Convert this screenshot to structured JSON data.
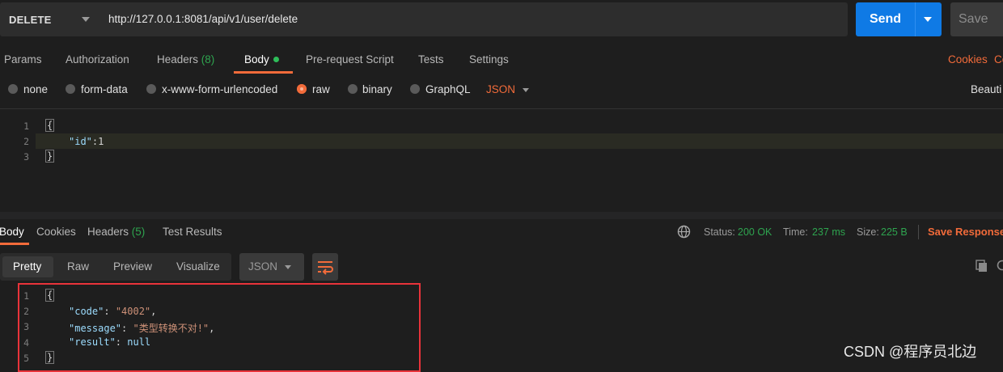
{
  "request": {
    "method": "DELETE",
    "url": "http://127.0.0.1:8081/api/v1/user/delete",
    "send_label": "Send",
    "save_label": "Save"
  },
  "request_tabs": {
    "params": "Params",
    "authorization": "Authorization",
    "headers": "Headers",
    "headers_count": "(8)",
    "body": "Body",
    "prerequest": "Pre-request Script",
    "tests": "Tests",
    "settings": "Settings",
    "cookies": "Cookies",
    "code_partial": "Cc"
  },
  "body_types": {
    "none": "none",
    "form_data": "form-data",
    "urlencoded": "x-www-form-urlencoded",
    "raw": "raw",
    "binary": "binary",
    "graphql": "GraphQL",
    "format": "JSON",
    "beautify_partial": "Beauti"
  },
  "request_editor": {
    "lines": [
      {
        "n": "1",
        "text": "{"
      },
      {
        "n": "2",
        "key": "\"id\"",
        "sep": ":",
        "value": "1"
      },
      {
        "n": "3",
        "text": "}"
      }
    ]
  },
  "response_tabs": {
    "body": "Body",
    "cookies": "Cookies",
    "headers": "Headers",
    "headers_count": "(5)",
    "test_results": "Test Results"
  },
  "response_meta": {
    "status_label": "Status:",
    "status_value": "200 OK",
    "time_label": "Time:",
    "time_value": "237 ms",
    "size_label": "Size:",
    "size_value": "225 B",
    "save_response": "Save Response"
  },
  "view_modes": {
    "pretty": "Pretty",
    "raw": "Raw",
    "preview": "Preview",
    "visualize": "Visualize",
    "format": "JSON"
  },
  "response_editor": {
    "lines": [
      {
        "n": "1",
        "text": "{"
      },
      {
        "n": "2",
        "key": "\"code\"",
        "sep": ": ",
        "value": "\"4002\"",
        "trail": ","
      },
      {
        "n": "3",
        "key": "\"message\"",
        "sep": ": ",
        "value": "\"类型转换不对!\"",
        "trail": ","
      },
      {
        "n": "4",
        "key": "\"result\"",
        "sep": ": ",
        "value": "null"
      },
      {
        "n": "5",
        "text": "}"
      }
    ]
  },
  "watermark": "CSDN @程序员北边",
  "colors": {
    "accent": "#f26b3a",
    "send": "#0f7ae5",
    "success": "#2ea44f",
    "highlight_box": "#e8333a"
  }
}
